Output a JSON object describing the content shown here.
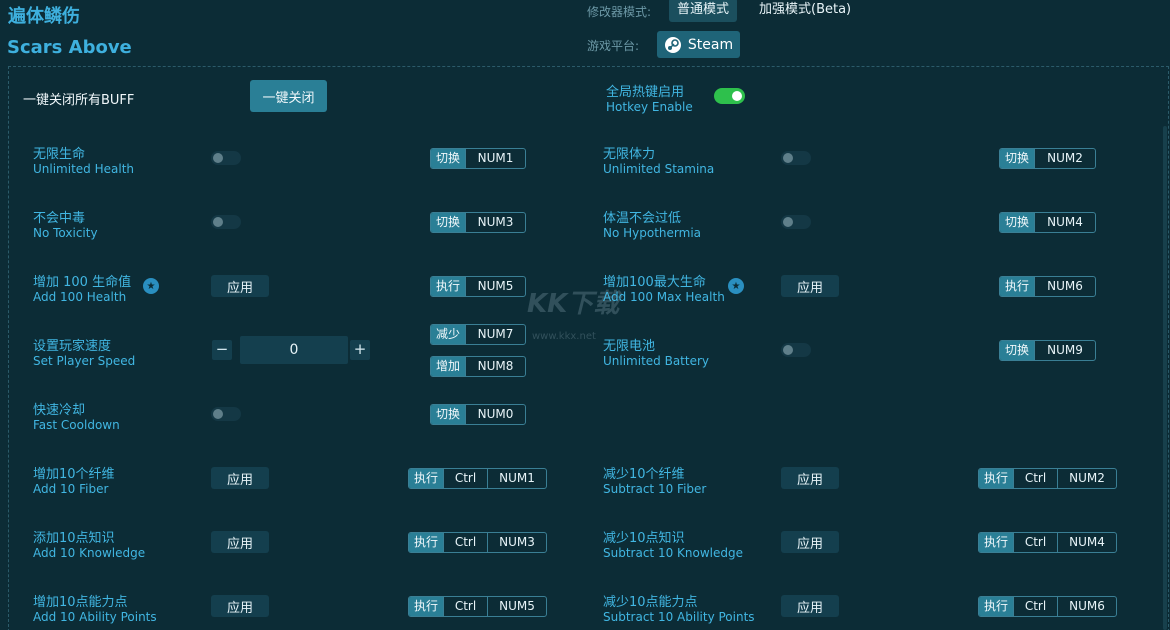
{
  "header": {
    "title_cn": "遍体鳞伤",
    "title_en": "Scars Above",
    "mode_label": "修改器模式:",
    "mode_normal": "普通模式",
    "mode_enhanced": "加强模式(Beta)",
    "platform_label": "游戏平台:",
    "platform_value": "Steam"
  },
  "global": {
    "close_all_label": "一键关闭所有BUFF",
    "close_all_button": "一键关闭",
    "hotkey_cn": "全局热键启用",
    "hotkey_en": "Hotkey Enable",
    "hotkey_enabled": true
  },
  "watermark": {
    "logo": "KK下载",
    "url": "www.kkx.net"
  },
  "cheats": [
    {
      "cn": "无限生命",
      "en": "Unlimited Health",
      "control": "toggle",
      "on": false,
      "hotkeys": [
        {
          "tag": "切换",
          "keys": [
            "NUM1"
          ]
        }
      ]
    },
    {
      "cn": "无限体力",
      "en": "Unlimited Stamina",
      "control": "toggle",
      "on": false,
      "hotkeys": [
        {
          "tag": "切换",
          "keys": [
            "NUM2"
          ]
        }
      ]
    },
    {
      "cn": "不会中毒",
      "en": "No Toxicity",
      "control": "toggle",
      "on": false,
      "hotkeys": [
        {
          "tag": "切换",
          "keys": [
            "NUM3"
          ]
        }
      ]
    },
    {
      "cn": "体温不会过低",
      "en": "No Hypothermia",
      "control": "toggle",
      "on": false,
      "hotkeys": [
        {
          "tag": "切换",
          "keys": [
            "NUM4"
          ]
        }
      ]
    },
    {
      "cn": "增加 100 生命值",
      "en": "Add 100 Health",
      "control": "apply",
      "apply_label": "应用",
      "hotkeys": [
        {
          "tag": "执行",
          "keys": [
            "NUM5"
          ]
        }
      ]
    },
    {
      "cn": "增加100最大生命",
      "en": "Add 100 Max Health",
      "control": "apply",
      "apply_label": "应用",
      "hotkeys": [
        {
          "tag": "执行",
          "keys": [
            "NUM6"
          ]
        }
      ]
    },
    {
      "cn": "设置玩家速度",
      "en": "Set Player Speed",
      "control": "stepper",
      "value": "0",
      "minus": "−",
      "plus": "+",
      "hotkeys": [
        {
          "tag": "减少",
          "keys": [
            "NUM7"
          ]
        },
        {
          "tag": "增加",
          "keys": [
            "NUM8"
          ]
        }
      ]
    },
    {
      "cn": "无限电池",
      "en": "Unlimited Battery",
      "control": "toggle",
      "on": false,
      "hotkeys": [
        {
          "tag": "切换",
          "keys": [
            "NUM9"
          ]
        }
      ]
    },
    {
      "cn": "快速冷却",
      "en": "Fast Cooldown",
      "control": "toggle",
      "on": false,
      "hotkeys": [
        {
          "tag": "切换",
          "keys": [
            "NUM0"
          ]
        }
      ]
    },
    {
      "cn": "增加10个纤维",
      "en": "Add 10 Fiber",
      "control": "apply",
      "apply_label": "应用",
      "hotkeys": [
        {
          "tag": "执行",
          "keys": [
            "Ctrl",
            "NUM1"
          ]
        }
      ]
    },
    {
      "cn": "减少10个纤维",
      "en": "Subtract 10 Fiber",
      "control": "apply",
      "apply_label": "应用",
      "hotkeys": [
        {
          "tag": "执行",
          "keys": [
            "Ctrl",
            "NUM2"
          ]
        }
      ]
    },
    {
      "cn": "添加10点知识",
      "en": "Add 10 Knowledge",
      "control": "apply",
      "apply_label": "应用",
      "hotkeys": [
        {
          "tag": "执行",
          "keys": [
            "Ctrl",
            "NUM3"
          ]
        }
      ]
    },
    {
      "cn": "减少10点知识",
      "en": "Subtract 10 Knowledge",
      "control": "apply",
      "apply_label": "应用",
      "hotkeys": [
        {
          "tag": "执行",
          "keys": [
            "Ctrl",
            "NUM4"
          ]
        }
      ]
    },
    {
      "cn": "增加10点能力点",
      "en": "Add 10 Ability Points",
      "control": "apply",
      "apply_label": "应用",
      "hotkeys": [
        {
          "tag": "执行",
          "keys": [
            "Ctrl",
            "NUM5"
          ]
        }
      ]
    },
    {
      "cn": "减少10点能力点",
      "en": "Subtract 10 Ability Points",
      "control": "apply",
      "apply_label": "应用",
      "hotkeys": [
        {
          "tag": "执行",
          "keys": [
            "Ctrl",
            "NUM6"
          ]
        }
      ]
    }
  ]
}
